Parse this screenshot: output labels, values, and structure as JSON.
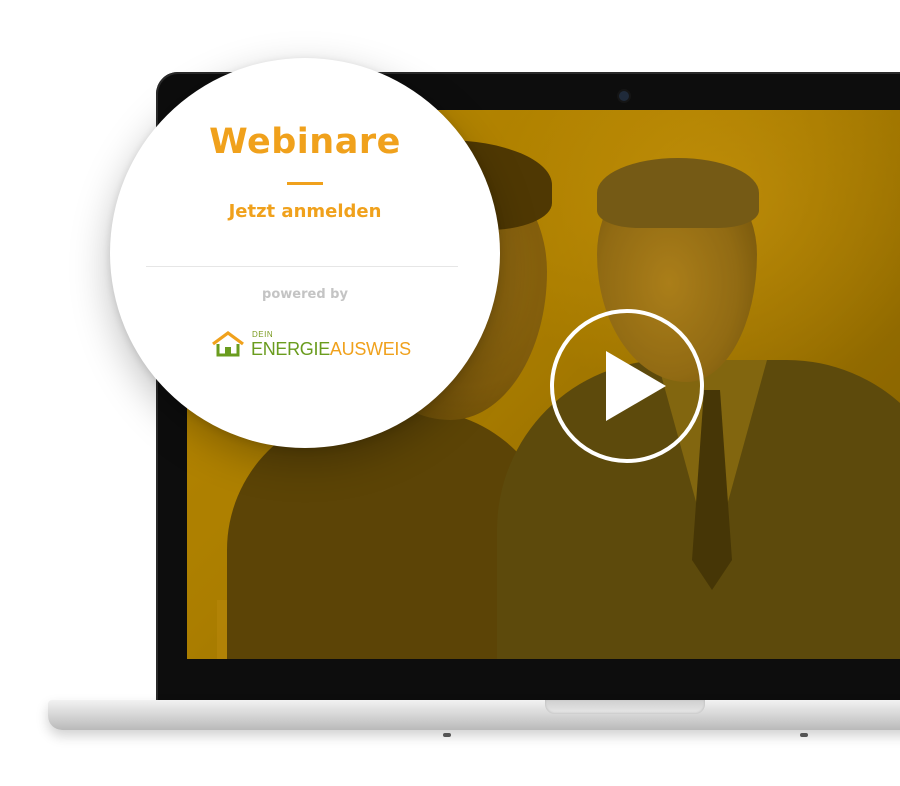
{
  "callout": {
    "title": "Webinare",
    "cta": "Jetzt anmelden",
    "powered_by": "powered by"
  },
  "logo": {
    "prefix": "DEIN",
    "word_primary": "ENERGIE",
    "word_secondary": "AUSWEIS"
  },
  "icons": {
    "play": "play-icon",
    "logo_house": "house-icon"
  },
  "colors": {
    "accent": "#f0a11c",
    "logo_green": "#6a9c1e",
    "muted_text": "#c4c4c4",
    "video_tint": "#b88800"
  }
}
